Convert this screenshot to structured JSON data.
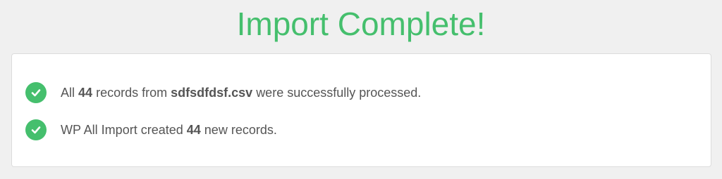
{
  "header": {
    "title": "Import Complete!"
  },
  "messages": [
    {
      "icon": "check-circle-icon",
      "prefix": "All",
      "count": "44",
      "middle": "records from",
      "filename": "sdfsdfdsf.csv",
      "suffix": "were successfully processed."
    },
    {
      "icon": "check-circle-icon",
      "prefix": "WP All Import created",
      "count": "44",
      "suffix": "new records."
    }
  ],
  "colors": {
    "accent": "#45bf6d",
    "background": "#f0f0f0",
    "text": "#555555"
  }
}
